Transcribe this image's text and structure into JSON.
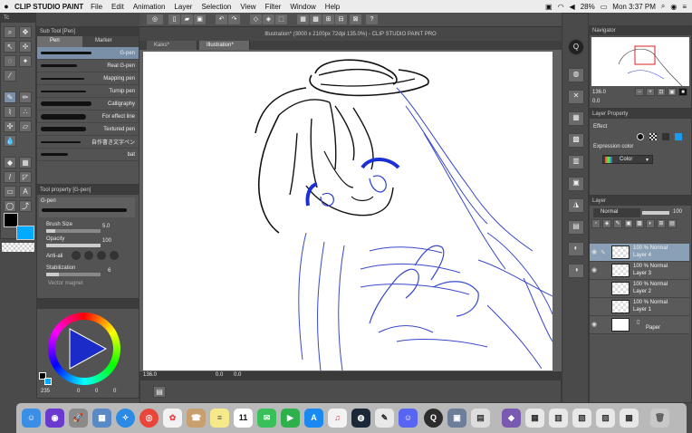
{
  "menubar": {
    "apple": "",
    "app_name": "CLIP STUDIO PAINT",
    "items": [
      "File",
      "Edit",
      "Animation",
      "Layer",
      "Selection",
      "View",
      "Filter",
      "Window",
      "Help"
    ],
    "battery": "28%",
    "clock": "Mon 3:37 PM"
  },
  "window": {
    "title": "Illustration* (3000 x 2100px 72dpi 135.0%) - CLIP STUDIO PAINT PRO"
  },
  "tabs": [
    "Kaixs*",
    "Illustration*"
  ],
  "sub_tool": {
    "panel_title": "Sub Tool [Pen]",
    "tabs": [
      "Pen",
      "Marker"
    ],
    "items": [
      "G-pen",
      "Real G-pen",
      "Mapping pen",
      "Turnip pen",
      "Calligraphy",
      "For effect line",
      "Textured pen",
      "自作書き文字ペン",
      "bat"
    ]
  },
  "tool_property": {
    "panel_title": "Tool property [G-pen]",
    "tool_name": "G-pen",
    "brush_size_label": "Brush Size",
    "brush_size_value": "5.0",
    "opacity_label": "Opacity",
    "opacity_value": "100",
    "anti_alias_label": "Anti-ali",
    "stabilization_label": "Stabilization",
    "stabilization_value": "6",
    "vector_magnet_label": "Vector magnet"
  },
  "color": {
    "main": "#000000",
    "sub": "#00aaff",
    "values": [
      "0",
      "0",
      "0"
    ],
    "value_label": "235"
  },
  "navigator": {
    "panel_title": "Navigator",
    "zoom": "136.0",
    "angle": "0.0"
  },
  "layer_property": {
    "panel_title": "Layer Property",
    "effect_label": "Effect",
    "expression_label": "Expression color",
    "expression_value": "Color"
  },
  "layer_panel": {
    "panel_title": "Layer",
    "blend_mode": "Normal",
    "opacity": "100",
    "layers": [
      {
        "opacity_mode": "100 % Normal",
        "name": "Layer 4",
        "selected": true
      },
      {
        "opacity_mode": "100 % Normal",
        "name": "Layer 3",
        "selected": false
      },
      {
        "opacity_mode": "100 % Normal",
        "name": "Layer 2",
        "selected": false
      },
      {
        "opacity_mode": "100 % Normal",
        "name": "Layer 1",
        "selected": false
      },
      {
        "opacity_mode": "",
        "name": "Paper",
        "selected": false
      }
    ]
  },
  "status": {
    "zoom": "136.0",
    "angle": "0.0",
    "coords": "0.0"
  },
  "dock": {
    "calendar_day": "11",
    "apps": [
      "Finder",
      "Siri",
      "Launchpad",
      "Preview",
      "Safari",
      "Chrome",
      "Photos",
      "Contacts",
      "Notes",
      "Calendar",
      "Messages",
      "FaceTime",
      "App Store",
      "Music",
      "Steam",
      "Clip Studio",
      "Discord",
      "QuickTime",
      "Image Capture",
      "TextEdit",
      "Keka",
      "Utilities",
      "Trash"
    ]
  }
}
